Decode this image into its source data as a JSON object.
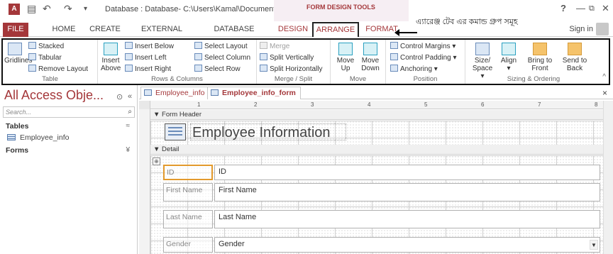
{
  "window": {
    "app_icon": "A",
    "title": "Database : Database- C:\\Users\\Kamal\\Document...",
    "tools_label": "FORM DESIGN TOOLS",
    "help": "?",
    "minimize": "—",
    "restore": "⧉",
    "close": "✕"
  },
  "quick_access": {
    "save_icon": "▤",
    "undo_icon": "↶",
    "redo_icon": "↷",
    "customize_icon": "▾"
  },
  "tabs": [
    "FILE",
    "HOME",
    "CREATE",
    "EXTERNAL DATA",
    "DATABASE TOOLS",
    "DESIGN",
    "ARRANGE",
    "FORMAT"
  ],
  "active_tab": "ARRANGE",
  "account": {
    "signin": "Sign in"
  },
  "annotation": "এ্যারেঞ্জ টেব এর কমান্ড গ্রুপ সমূহ",
  "ribbon": {
    "table": {
      "label": "Table",
      "gridlines": "Gridlines",
      "stacked": "Stacked",
      "tabular": "Tabular",
      "remove_layout": "Remove Layout"
    },
    "rows_columns": {
      "label": "Rows & Columns",
      "insert_above": "Insert Above",
      "insert_below": "Insert Below",
      "insert_left": "Insert Left",
      "insert_right": "Insert Right",
      "select_layout": "Select Layout",
      "select_column": "Select Column",
      "select_row": "Select Row"
    },
    "merge_split": {
      "label": "Merge / Split",
      "merge": "Merge",
      "split_vertically": "Split Vertically",
      "split_horizontally": "Split Horizontally"
    },
    "move": {
      "label": "Move",
      "move_up": "Move Up",
      "move_down": "Move Down"
    },
    "position": {
      "label": "Position",
      "control_margins": "Control Margins ▾",
      "control_padding": "Control Padding ▾",
      "anchoring": "Anchoring ▾"
    },
    "sizing": {
      "label": "Sizing & Ordering",
      "size_space": "Size/ Space ▾",
      "align": "Align ▾",
      "bring_to_front": "Bring to Front",
      "send_to_back": "Send to Back"
    },
    "collapse": "^"
  },
  "nav": {
    "title": "All Access Obje...",
    "search_placeholder": "Search...",
    "search_icon": "⌕",
    "sections": [
      {
        "name": "Tables",
        "chevron": "≈",
        "items": [
          "Employee_info"
        ]
      },
      {
        "name": "Forms",
        "chevron": "¥",
        "items": []
      }
    ],
    "menu_icon": "⊙",
    "shutter_icon": "«"
  },
  "doc_tabs": [
    "Employee_info",
    "Employee_info_form"
  ],
  "active_doc_tab": "Employee_info_form",
  "doc_close": "×",
  "ruler_numbers": [
    "1",
    "2",
    "3",
    "4",
    "5",
    "6",
    "7",
    "8"
  ],
  "form": {
    "header_section": "Form Header",
    "detail_section": "Detail",
    "header_title": "Employee Information",
    "fields": [
      {
        "label": "ID",
        "control": "ID"
      },
      {
        "label": "First Name",
        "control": "First Name"
      },
      {
        "label": "Last Name",
        "control": "Last Name"
      },
      {
        "label": "Gender",
        "control": "Gender"
      }
    ],
    "layout_handle": "⊕",
    "dropdown_arrow": "▼"
  }
}
